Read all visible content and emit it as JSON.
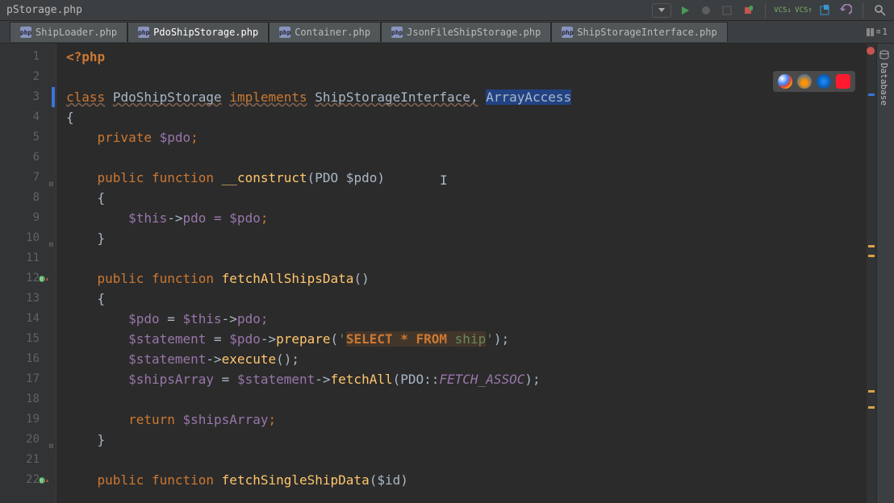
{
  "titlebar": {
    "breadcrumb": "pStorage.php"
  },
  "toolbar": {
    "vcs_down": "VCS↓",
    "vcs_up": "VCS↑"
  },
  "tabs": [
    {
      "label": "ShipLoader.php"
    },
    {
      "label": "PdoShipStorage.php"
    },
    {
      "label": "Container.php"
    },
    {
      "label": "JsonFileShipStorage.php"
    },
    {
      "label": "ShipStorageInterface.php"
    }
  ],
  "tab_extras": {
    "count": "1"
  },
  "side": {
    "database": "Database"
  },
  "code": {
    "lines": [
      "1",
      "2",
      "3",
      "4",
      "5",
      "6",
      "7",
      "8",
      "9",
      "10",
      "11",
      "12",
      "13",
      "14",
      "15",
      "16",
      "17",
      "18",
      "19",
      "20",
      "21",
      "22"
    ],
    "l1_open": "<?php",
    "l3_class": "class",
    "l3_name": "PdoShipStorage",
    "l3_impl": "implements",
    "l3_iface": "ShipStorageInterface,",
    "l3_aa": "ArrayAccess",
    "l4": "{",
    "l5_private": "private",
    "l5_pdo": "$pdo",
    "l5_semi": ";",
    "l7_public": "public",
    "l7_function": "function",
    "l7_name": "__construct",
    "l7_sig": "(PDO $pdo)",
    "l8": "{",
    "l9_this": "$this",
    "l9_arrow": "->",
    "l9_prop": "pdo = ",
    "l9_param": "$pdo",
    "l9_semi": ";",
    "l10": "}",
    "l12_public": "public",
    "l12_function": "function",
    "l12_name": "fetchAllShipsData",
    "l12_paren": "()",
    "l13": "{",
    "l14_var": "$pdo",
    "l14_eq": " = ",
    "l14_this": "$this",
    "l14_arrow": "->",
    "l14_prop": "pdo;",
    "l15_var": "$statement",
    "l15_eq": " = ",
    "l15_pdo": "$pdo",
    "l15_arrow": "->",
    "l15_method": "prepare",
    "l15_paren1": "(",
    "l15_q1": "'",
    "l15_sql1": "SELECT * FROM ",
    "l15_sql2": "ship",
    "l15_q2": "'",
    "l15_paren2": ");",
    "l16_var": "$statement",
    "l16_arrow": "->",
    "l16_method": "execute",
    "l16_end": "();",
    "l17_var": "$shipsArray",
    "l17_eq": " = ",
    "l17_st": "$statement",
    "l17_arrow": "->",
    "l17_method": "fetchAll",
    "l17_paren1": "(PDO::",
    "l17_const": "FETCH_ASSOC",
    "l17_paren2": ");",
    "l19_return": "return",
    "l19_var": "$shipsArray",
    "l19_semi": ";",
    "l20": "}",
    "l22_public": "public",
    "l22_function": "function",
    "l22_name": "fetchSingleShipData",
    "l22_sig": "($id)"
  }
}
